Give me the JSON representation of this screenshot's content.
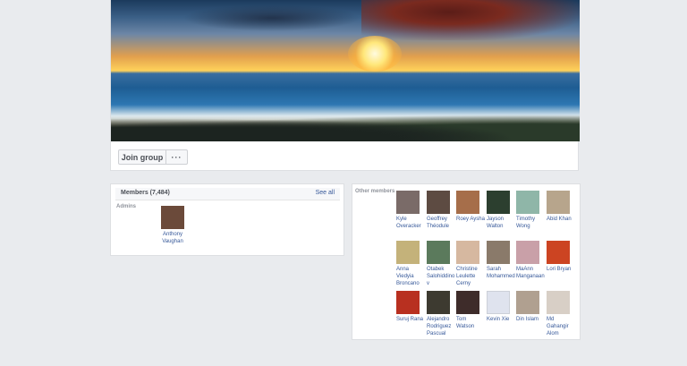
{
  "actions": {
    "join_label": "Join group",
    "more_label": "···"
  },
  "members": {
    "title": "Members (7,484)",
    "see_all": "See all",
    "admins_label": "Admins",
    "admins": [
      {
        "name": "Anthony Vaughan",
        "color": "#6b4a3a"
      }
    ]
  },
  "other": {
    "label": "Other members",
    "people": [
      {
        "name": "Kyle Overacker",
        "color": "#7a6b68"
      },
      {
        "name": "Geoffrey Théodule",
        "color": "#5d4b42"
      },
      {
        "name": "Roey Aysha",
        "color": "#a66e4a"
      },
      {
        "name": "Jayson Walton",
        "color": "#2c3f2f"
      },
      {
        "name": "Timothy Wong",
        "color": "#8fb6a8"
      },
      {
        "name": "Abid Khan",
        "color": "#b7a58c"
      },
      {
        "name": "Anna Viedyia Broncano",
        "color": "#c4b27a"
      },
      {
        "name": "Otabek Salohiddinov",
        "color": "#5b7a5c"
      },
      {
        "name": "Christine Leulette Cerny",
        "color": "#d6b8a0"
      },
      {
        "name": "Sarah Mohammed",
        "color": "#8a7a6a"
      },
      {
        "name": "MaAnn Manganaan",
        "color": "#c9a0a8"
      },
      {
        "name": "Lori Bryan",
        "color": "#cc4422"
      },
      {
        "name": "Suruj Rana",
        "color": "#b83020"
      },
      {
        "name": "Alejandro Rodriguez Pascual",
        "color": "#3d3a30"
      },
      {
        "name": "Tom Watson",
        "color": "#3e2c2a"
      },
      {
        "name": "Kevin Xie",
        "color": "#dfe3ee"
      },
      {
        "name": "Din Islam",
        "color": "#b0a090"
      },
      {
        "name": "Md Gahangir Alom",
        "color": "#d8cfc6"
      }
    ]
  }
}
